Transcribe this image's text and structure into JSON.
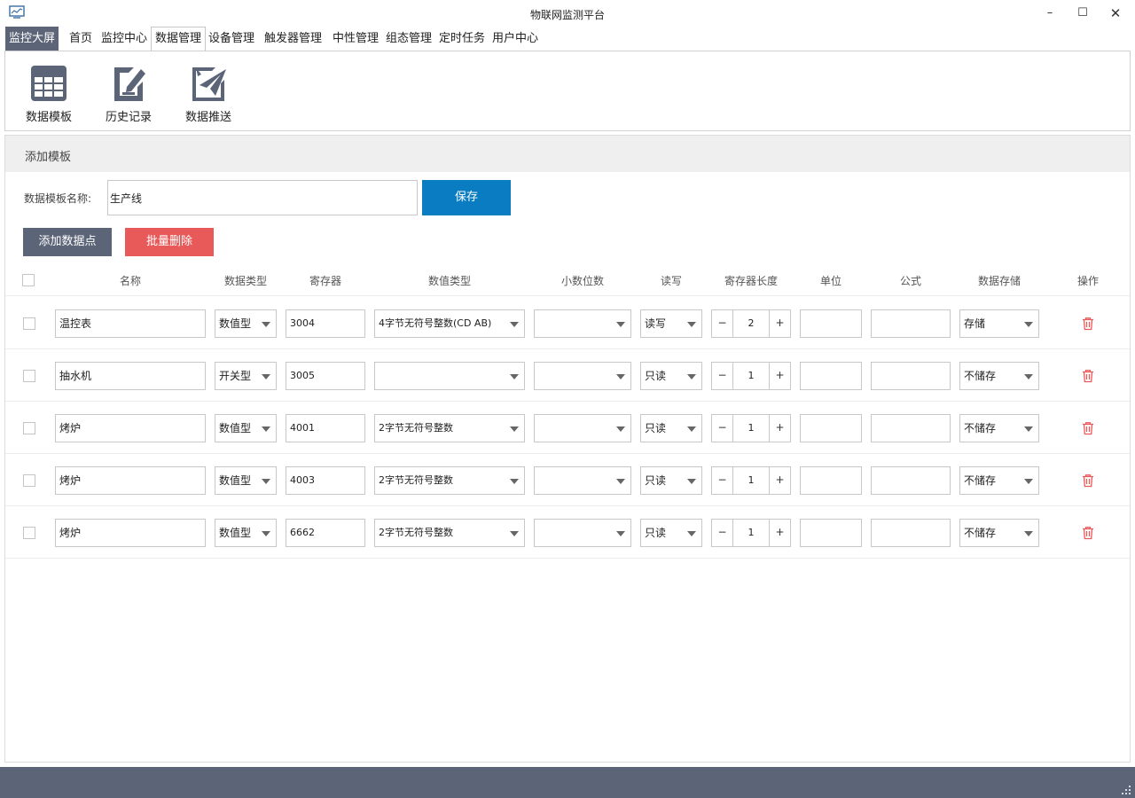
{
  "window": {
    "title": "物联网监测平台",
    "minimize": "–",
    "maximize": "☐",
    "close": "✕"
  },
  "menu": {
    "highlight": "监控大屏",
    "items": [
      "首页",
      "监控中心",
      "数据管理",
      "设备管理",
      "触发器管理",
      "中性管理",
      "组态管理",
      "定时任务",
      "用户中心"
    ],
    "selected_index": 2
  },
  "toolbar": [
    {
      "label": "数据模板",
      "icon": "table-grid-icon"
    },
    {
      "label": "历史记录",
      "icon": "edit-note-icon"
    },
    {
      "label": "数据推送",
      "icon": "send-plane-icon"
    }
  ],
  "section": {
    "title": "添加模板"
  },
  "form": {
    "name_label": "数据模板名称:",
    "name_value": "生产线",
    "save": "保存"
  },
  "actions": {
    "add": "添加数据点",
    "batch_delete": "批量删除"
  },
  "table": {
    "headers": [
      "名称",
      "数据类型",
      "寄存器",
      "数值类型",
      "小数位数",
      "读写",
      "寄存器长度",
      "单位",
      "公式",
      "数据存储",
      "操作"
    ],
    "rows": [
      {
        "name": "温控表",
        "data_type": "数值型",
        "register": "3004",
        "value_type": "4字节无符号整数(CD AB)",
        "decimals": "",
        "rw": "读写",
        "length": "2",
        "unit": "",
        "formula": "",
        "storage": "存储"
      },
      {
        "name": "抽水机",
        "data_type": "开关型",
        "register": "3005",
        "value_type": "",
        "decimals": "",
        "rw": "只读",
        "length": "1",
        "unit": "",
        "formula": "",
        "storage": "不储存"
      },
      {
        "name": "烤炉",
        "data_type": "数值型",
        "register": "4001",
        "value_type": "2字节无符号整数",
        "decimals": "",
        "rw": "只读",
        "length": "1",
        "unit": "",
        "formula": "",
        "storage": "不储存"
      },
      {
        "name": "烤炉",
        "data_type": "数值型",
        "register": "4003",
        "value_type": "2字节无符号整数",
        "decimals": "",
        "rw": "只读",
        "length": "1",
        "unit": "",
        "formula": "",
        "storage": "不储存"
      },
      {
        "name": "烤炉",
        "data_type": "数值型",
        "register": "6662",
        "value_type": "2字节无符号整数",
        "decimals": "",
        "rw": "只读",
        "length": "1",
        "unit": "",
        "formula": "",
        "storage": "不储存"
      }
    ]
  },
  "stepper": {
    "minus": "−",
    "plus": "+"
  },
  "colors": {
    "accent": "#0a7dc2",
    "dark": "#5c6478",
    "danger": "#e85a5a",
    "header_bg": "#efefef"
  }
}
